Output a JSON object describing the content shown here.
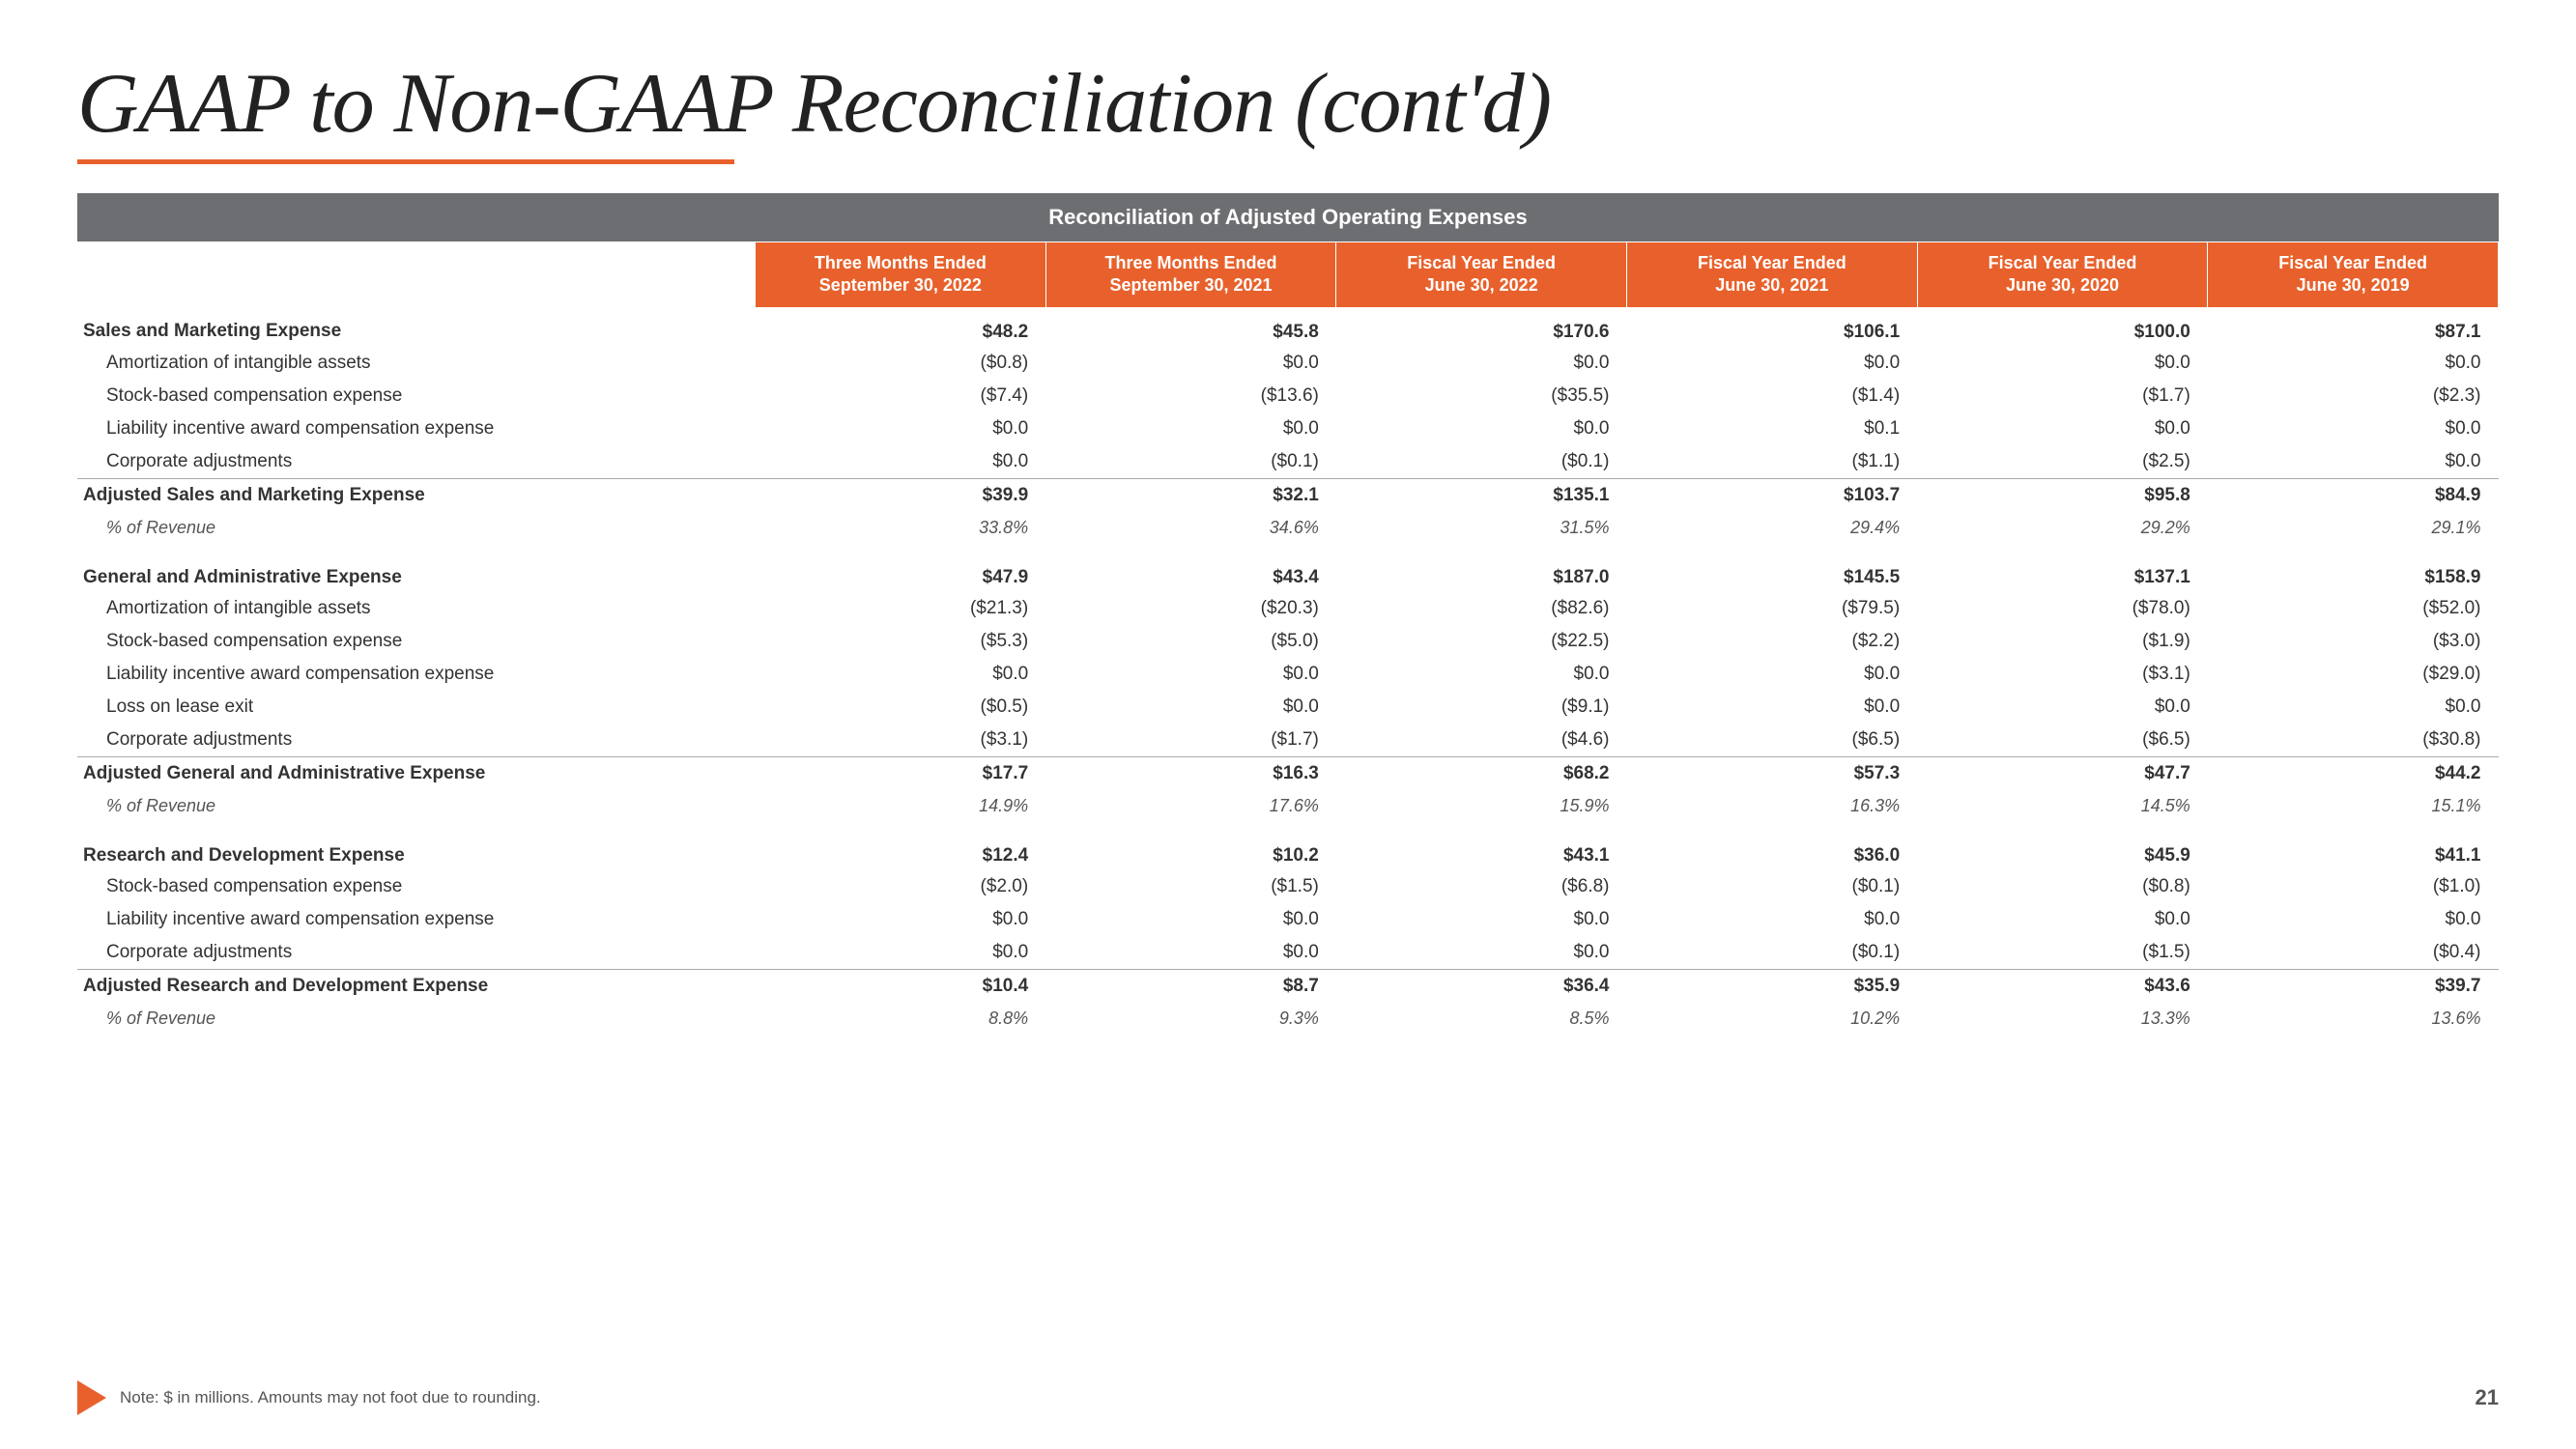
{
  "title": "GAAP to Non-GAAP Reconciliation (cont'd)",
  "section_header": "Reconciliation of Adjusted Operating Expenses",
  "columns": [
    {
      "label": "Three Months Ended\nSeptember 30, 2022"
    },
    {
      "label": "Three Months Ended\nSeptember 30, 2021"
    },
    {
      "label": "Fiscal Year Ended\nJune 30, 2022"
    },
    {
      "label": "Fiscal Year Ended\nJune 30, 2021"
    },
    {
      "label": "Fiscal Year Ended\nJune 30, 2020"
    },
    {
      "label": "Fiscal Year Ended\nJune 30, 2019"
    }
  ],
  "sections": [
    {
      "main_label": "Sales and Marketing Expense",
      "main_values": [
        "$48.2",
        "$45.8",
        "$170.6",
        "$106.1",
        "$100.0",
        "$87.1"
      ],
      "sub_rows": [
        {
          "label": "Amortization of intangible assets",
          "values": [
            "($0.8)",
            "$0.0",
            "$0.0",
            "$0.0",
            "$0.0",
            "$0.0"
          ]
        },
        {
          "label": "Stock-based compensation expense",
          "values": [
            "($7.4)",
            "($13.6)",
            "($35.5)",
            "($1.4)",
            "($1.7)",
            "($2.3)"
          ]
        },
        {
          "label": "Liability incentive award compensation expense",
          "values": [
            "$0.0",
            "$0.0",
            "$0.0",
            "$0.1",
            "$0.0",
            "$0.0"
          ]
        },
        {
          "label": "Corporate adjustments",
          "values": [
            "$0.0",
            "($0.1)",
            "($0.1)",
            "($1.1)",
            "($2.5)",
            "$0.0"
          ]
        }
      ],
      "total_label": "Adjusted Sales and Marketing Expense",
      "total_values": [
        "$39.9",
        "$32.1",
        "$135.1",
        "$103.7",
        "$95.8",
        "$84.9"
      ],
      "pct_label": "% of Revenue",
      "pct_values": [
        "33.8%",
        "34.6%",
        "31.5%",
        "29.4%",
        "29.2%",
        "29.1%"
      ]
    },
    {
      "main_label": "General and Administrative Expense",
      "main_values": [
        "$47.9",
        "$43.4",
        "$187.0",
        "$145.5",
        "$137.1",
        "$158.9"
      ],
      "sub_rows": [
        {
          "label": "Amortization of intangible assets",
          "values": [
            "($21.3)",
            "($20.3)",
            "($82.6)",
            "($79.5)",
            "($78.0)",
            "($52.0)"
          ]
        },
        {
          "label": "Stock-based compensation expense",
          "values": [
            "($5.3)",
            "($5.0)",
            "($22.5)",
            "($2.2)",
            "($1.9)",
            "($3.0)"
          ]
        },
        {
          "label": "Liability incentive award compensation expense",
          "values": [
            "$0.0",
            "$0.0",
            "$0.0",
            "$0.0",
            "($3.1)",
            "($29.0)"
          ]
        },
        {
          "label": "Loss on lease exit",
          "values": [
            "($0.5)",
            "$0.0",
            "($9.1)",
            "$0.0",
            "$0.0",
            "$0.0"
          ]
        },
        {
          "label": "Corporate adjustments",
          "values": [
            "($3.1)",
            "($1.7)",
            "($4.6)",
            "($6.5)",
            "($6.5)",
            "($30.8)"
          ]
        }
      ],
      "total_label": "Adjusted General and Administrative Expense",
      "total_values": [
        "$17.7",
        "$16.3",
        "$68.2",
        "$57.3",
        "$47.7",
        "$44.2"
      ],
      "pct_label": "% of Revenue",
      "pct_values": [
        "14.9%",
        "17.6%",
        "15.9%",
        "16.3%",
        "14.5%",
        "15.1%"
      ]
    },
    {
      "main_label": "Research and Development Expense",
      "main_values": [
        "$12.4",
        "$10.2",
        "$43.1",
        "$36.0",
        "$45.9",
        "$41.1"
      ],
      "sub_rows": [
        {
          "label": "Stock-based compensation expense",
          "values": [
            "($2.0)",
            "($1.5)",
            "($6.8)",
            "($0.1)",
            "($0.8)",
            "($1.0)"
          ]
        },
        {
          "label": "Liability incentive award compensation expense",
          "values": [
            "$0.0",
            "$0.0",
            "$0.0",
            "$0.0",
            "$0.0",
            "$0.0"
          ]
        },
        {
          "label": "Corporate adjustments",
          "values": [
            "$0.0",
            "$0.0",
            "$0.0",
            "($0.1)",
            "($1.5)",
            "($0.4)"
          ]
        }
      ],
      "total_label": "Adjusted Research and Development Expense",
      "total_values": [
        "$10.4",
        "$8.7",
        "$36.4",
        "$35.9",
        "$43.6",
        "$39.7"
      ],
      "pct_label": "% of Revenue",
      "pct_values": [
        "8.8%",
        "9.3%",
        "8.5%",
        "10.2%",
        "13.3%",
        "13.6%"
      ]
    }
  ],
  "footer": {
    "note": "Note: $ in millions. Amounts may not foot due to rounding.",
    "page": "21"
  }
}
